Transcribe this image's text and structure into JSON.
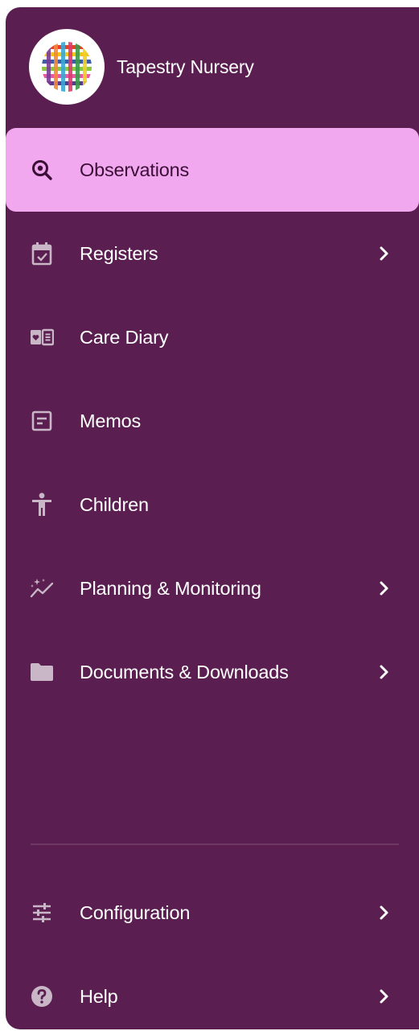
{
  "brand": {
    "name": "Tapestry Nursery",
    "logo_icon": "woven-tapestry-logo"
  },
  "colors": {
    "sidebar_bg": "#5a1f50",
    "active_bg": "#f1a8ef",
    "active_text": "#3b0f36",
    "icon": "#c9b6c6",
    "text": "#ffffff"
  },
  "nav": {
    "items": [
      {
        "label": "Observations",
        "icon": "observation-search-icon",
        "active": true,
        "has_submenu": false
      },
      {
        "label": "Registers",
        "icon": "calendar-check-icon",
        "active": false,
        "has_submenu": true
      },
      {
        "label": "Care Diary",
        "icon": "care-diary-book-icon",
        "active": false,
        "has_submenu": false
      },
      {
        "label": "Memos",
        "icon": "memo-icon",
        "active": false,
        "has_submenu": false
      },
      {
        "label": "Children",
        "icon": "child-figure-icon",
        "active": false,
        "has_submenu": false
      },
      {
        "label": "Planning & Monitoring",
        "icon": "sparkle-trend-icon",
        "active": false,
        "has_submenu": true
      },
      {
        "label": "Documents & Downloads",
        "icon": "folder-icon",
        "active": false,
        "has_submenu": true
      }
    ]
  },
  "footer": {
    "items": [
      {
        "label": "Configuration",
        "icon": "sliders-icon",
        "has_submenu": true
      },
      {
        "label": "Help",
        "icon": "help-icon",
        "has_submenu": true
      }
    ]
  }
}
